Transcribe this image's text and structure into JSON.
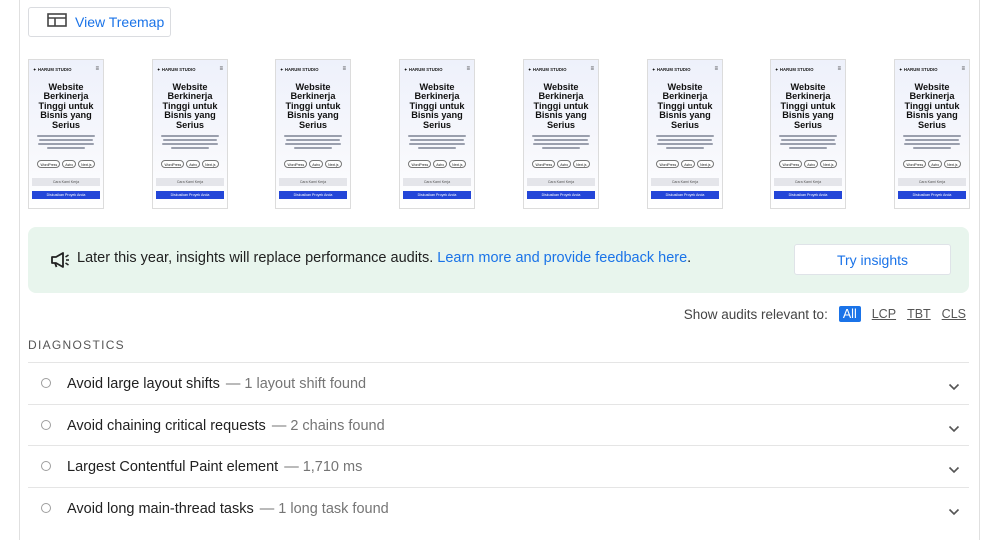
{
  "toolbar": {
    "treemap_label": "View Treemap"
  },
  "filmstrip": {
    "frame_count": 8,
    "brand": "✦ HARUM STUDIO",
    "headline": [
      "Website",
      "Berkinerja",
      "Tinggi untuk",
      "Bisnis yang",
      "Serius"
    ],
    "chips": [
      "WordPress",
      "Astro",
      "Next.js"
    ],
    "grey_button": "Cara Kami Kerja",
    "blue_button": "Diskusikan Proyek Anda"
  },
  "notice": {
    "text": "Later this year, insights will replace performance audits. ",
    "link": "Learn more and provide feedback here",
    "period": ".",
    "button": "Try insights",
    "bg_color": "#e8f5ed"
  },
  "filters": {
    "label": "Show audits relevant to:",
    "options": [
      "All",
      "LCP",
      "TBT",
      "CLS"
    ],
    "active": "All",
    "accent": "#1a73e8"
  },
  "diagnostics": {
    "heading": "DIAGNOSTICS",
    "items": [
      {
        "title": "Avoid large layout shifts",
        "display": "— 1 layout shift found"
      },
      {
        "title": "Avoid chaining critical requests",
        "display": "— 2 chains found"
      },
      {
        "title": "Largest Contentful Paint element",
        "display": "— 1,710 ms"
      },
      {
        "title": "Avoid long main-thread tasks",
        "display": "— 1 long task found"
      }
    ]
  }
}
